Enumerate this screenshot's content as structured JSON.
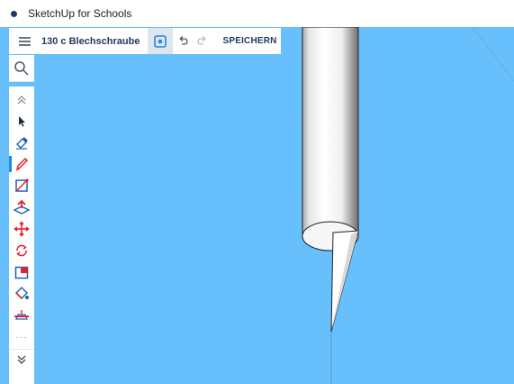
{
  "window": {
    "title": "SketchUp for Schools"
  },
  "header": {
    "document_title": "130 c Blechschraube",
    "save_label": "SPEICHERN"
  },
  "toolbar": {
    "tools": [
      {
        "name": "select",
        "icon": "arrow-cursor-icon",
        "active": false
      },
      {
        "name": "eraser",
        "icon": "eraser-icon",
        "active": false
      },
      {
        "name": "line",
        "icon": "pencil-icon",
        "active": true
      },
      {
        "name": "rectangle",
        "icon": "rectangle-icon",
        "active": false
      },
      {
        "name": "push-pull",
        "icon": "push-pull-icon",
        "active": false
      },
      {
        "name": "move",
        "icon": "move-icon",
        "active": false
      },
      {
        "name": "rotate",
        "icon": "rotate-icon",
        "active": false
      },
      {
        "name": "scale",
        "icon": "scale-icon",
        "active": false
      },
      {
        "name": "paint-bucket",
        "icon": "paint-bucket-icon",
        "active": false
      },
      {
        "name": "section-plane",
        "icon": "section-plane-icon",
        "active": false
      }
    ],
    "more_label": "···"
  },
  "colors": {
    "canvas": "#67c0fb",
    "brand": "#1f3a63",
    "active_accent": "#1a8ae6",
    "tool_red": "#e5222a",
    "tool_blue": "#1e62b8"
  }
}
